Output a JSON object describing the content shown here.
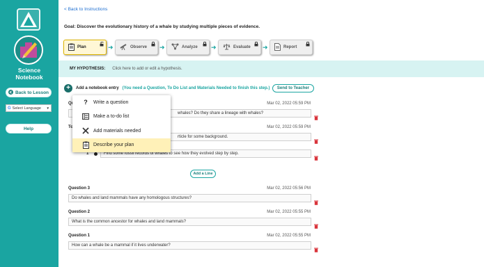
{
  "sidebar": {
    "title_line1": "Science",
    "title_line2": "Notebook",
    "back_to_lesson": "Back to Lesson",
    "language_label": "Select Language",
    "language_arrow": "▼",
    "help": "Help"
  },
  "header": {
    "back_link": "< Back to Instructions",
    "goal": "Goal: Discover the evolutionary history of a whale by studying multiple pieces of evidence."
  },
  "steps": [
    {
      "label": "Plan",
      "active": true
    },
    {
      "label": "Observe",
      "active": false
    },
    {
      "label": "Analyze",
      "active": false
    },
    {
      "label": "Evaluate",
      "active": false
    },
    {
      "label": "Report",
      "active": false
    }
  ],
  "hypothesis": {
    "label": "MY HYPOTHESIS:",
    "hint": "Click here to add or edit a hypothesis."
  },
  "notebook": {
    "add_entry_label": "Add a notebook entry",
    "add_entry_hint": "(You need a Question, To Do List and Materials Needed to finish this step.)",
    "send_to_teacher": "Send to Teacher",
    "add_line": "Add a Line"
  },
  "menu": {
    "items": [
      {
        "label": "Write a question",
        "icon": "question-icon"
      },
      {
        "label": "Make a to-do list",
        "icon": "list-icon"
      },
      {
        "label": "Add materials needed",
        "icon": "tools-icon"
      },
      {
        "label": "Describe your plan",
        "icon": "clipboard-icon"
      }
    ]
  },
  "entries": {
    "partial_q": {
      "title": "Questi",
      "date": "Mar 02, 2022 05:59 PM",
      "text": "whales? Do they share a lineage with whales?"
    },
    "todo": {
      "title": "To",
      "date": "Mar 02, 2022 05:59 PM",
      "line1": "rticle for some background.",
      "line2_number": "1",
      "line2": "Find some fossil records of whales to see how they evolved step by step."
    },
    "list": [
      {
        "title": "Question 3",
        "date": "Mar 02, 2022 05:56 PM",
        "text": "Do whales and land mammals have any homologous structures?"
      },
      {
        "title": "Question 2",
        "date": "Mar 02, 2022 05:55 PM",
        "text": "What is the common ancestor for whales and land mammals?"
      },
      {
        "title": "Question 1",
        "date": "Mar 02, 2022 05:55 PM",
        "text": "How can a whale be a mammal if it lives underwater?"
      }
    ]
  },
  "colors": {
    "accent": "#1aa5a1",
    "highlight": "#fff1b8",
    "delete": "#d9343b"
  }
}
